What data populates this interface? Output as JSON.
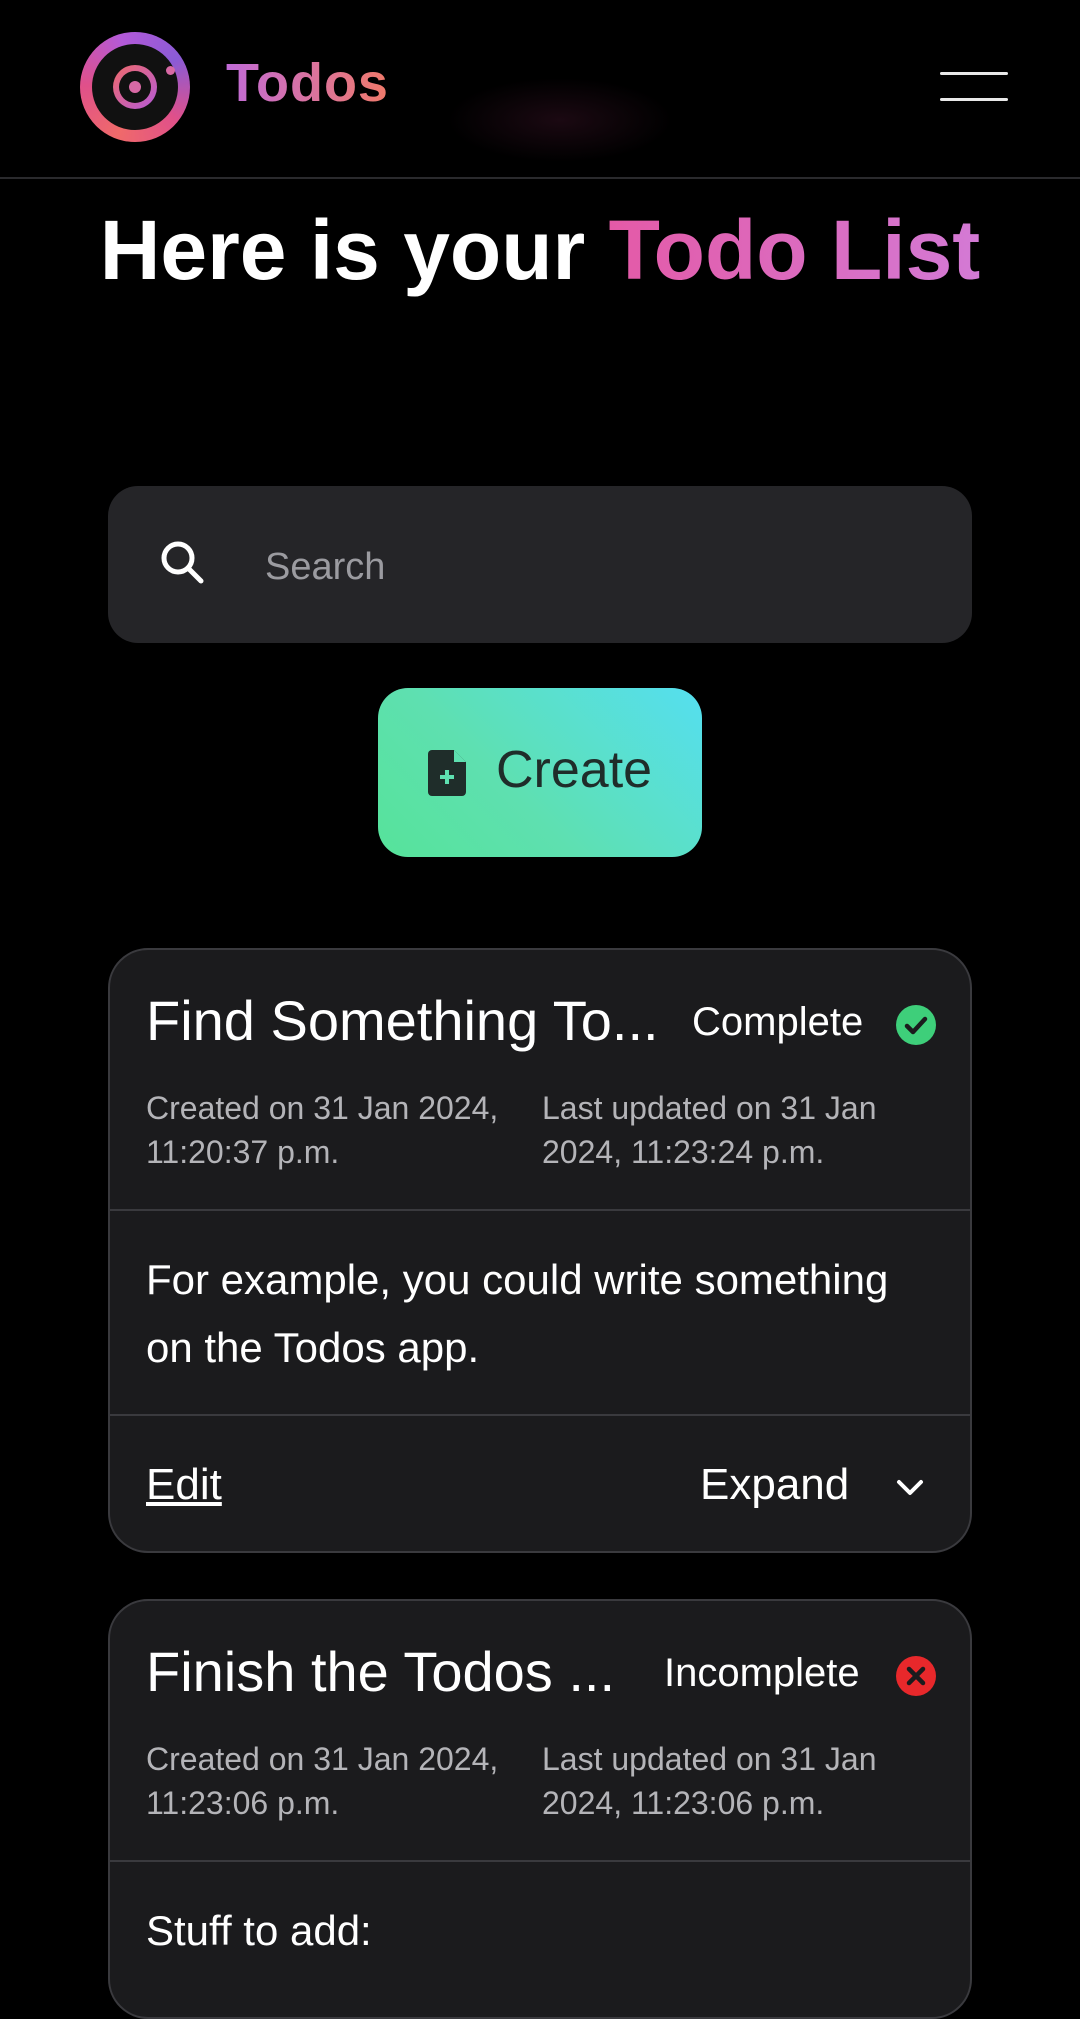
{
  "header": {
    "brand": "Todos",
    "logo_icon": "app-logo",
    "menu_icon": "hamburger-menu-icon"
  },
  "page": {
    "title_part1": "Here is your ",
    "title_accent": "Todo List"
  },
  "search": {
    "placeholder": "Search",
    "value": ""
  },
  "create": {
    "label": "Create",
    "icon": "file-plus-icon"
  },
  "todos": [
    {
      "title": "Find Something To...",
      "status": "Complete",
      "status_color": "#3ecf7a",
      "created": "Created on 31 Jan 2024, 11:20:37 p.m.",
      "updated": "Last updated on 31 Jan 2024, 11:23:24 p.m.",
      "description": "For example, you could write something on the Todos app.",
      "edit_label": "Edit",
      "expand_label": "Expand"
    },
    {
      "title": "Finish the Todos ...",
      "status": "Incomplete",
      "status_color": "#e8282b",
      "created": "Created on 31 Jan 2024, 11:23:06 p.m.",
      "updated": "Last updated on 31 Jan 2024, 11:23:06 p.m.",
      "description": "Stuff to add:"
    }
  ],
  "colors": {
    "accent_gradient_start": "#e45aa7",
    "accent_gradient_end": "#d37ad5",
    "create_gradient_start": "#56e39a",
    "create_gradient_end": "#55dff0"
  }
}
